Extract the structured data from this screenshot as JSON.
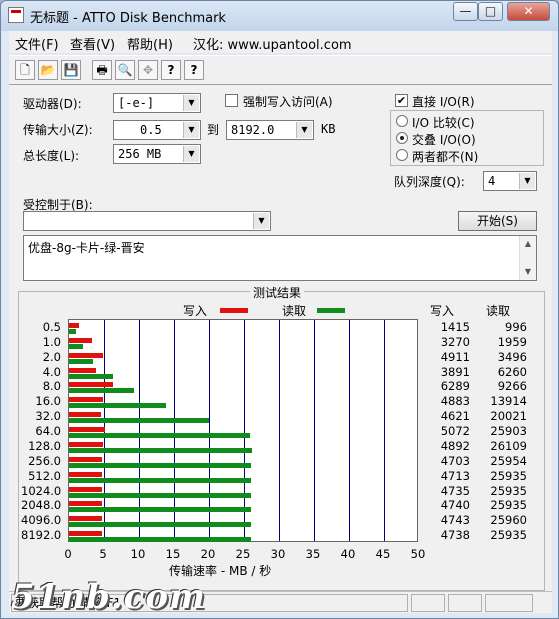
{
  "window": {
    "title": "无标题 - ATTO Disk Benchmark"
  },
  "menu": [
    "文件(F)",
    "查看(V)",
    "帮助(H)",
    "汉化: www.upantool.com"
  ],
  "toolbar": {
    "icons": [
      "new-file-icon",
      "open-folder-icon",
      "save-icon",
      "print-icon",
      "print-preview-icon",
      "move-icon",
      "help-icon",
      "context-help-icon"
    ],
    "glyphs": [
      "🗋",
      "📂",
      "💾",
      "🖶",
      "🔍",
      "✥",
      "?",
      "?"
    ]
  },
  "settings": {
    "drive_label": "驱动器(D):",
    "drive_value": "[-e-]",
    "force_write_label": "强制写入访问(A)",
    "transfer_size_label": "传输大小(Z):",
    "transfer_from": "0.5",
    "transfer_to_label": "到",
    "transfer_to": "8192.0",
    "transfer_unit": "KB",
    "total_length_label": "总长度(L):",
    "total_length": "256 MB",
    "direct_io_label": "直接 I/O(R)",
    "direct_io_checked": true,
    "io_compare_label": "I/O 比较(C)",
    "overlap_io_label": "交叠 I/O(O)",
    "neither_label": "两者都不(N)",
    "selected_mode": "overlap",
    "queue_depth_label": "队列深度(Q):",
    "queue_depth": "4",
    "controlled_by_label": "受控制于(B):",
    "controlled_by": "",
    "start_button": "开始(S)",
    "description": "优盘-8g-卡片-绿-晋安"
  },
  "results": {
    "group_title": "测试结果",
    "legend_write": "写入",
    "legend_read": "读取",
    "col_write": "写入",
    "col_read": "读取",
    "xlabel": "传输速率 - MB / 秒"
  },
  "colors": {
    "write": "#e31010",
    "read": "#108c1c",
    "grid": "#000080"
  },
  "chart_data": {
    "type": "bar",
    "orientation": "horizontal",
    "xlabel": "传输速率 - MB / 秒",
    "xlim": [
      0,
      50
    ],
    "xticks": [
      0,
      5,
      10,
      15,
      20,
      25,
      30,
      35,
      40,
      45,
      50
    ],
    "categories": [
      "0.5",
      "1.0",
      "2.0",
      "4.0",
      "8.0",
      "16.0",
      "32.0",
      "64.0",
      "128.0",
      "256.0",
      "512.0",
      "1024.0",
      "2048.0",
      "4096.0",
      "8192.0"
    ],
    "series": [
      {
        "name": "写入",
        "values_kb_s": [
          1415,
          3270,
          4911,
          3891,
          6289,
          4883,
          4621,
          5072,
          4892,
          4703,
          4713,
          4735,
          4740,
          4743,
          4738
        ]
      },
      {
        "name": "读取",
        "values_kb_s": [
          996,
          1959,
          3496,
          6260,
          9266,
          13914,
          20021,
          25903,
          26109,
          25954,
          25935,
          25935,
          25935,
          25960,
          25935
        ]
      }
    ]
  },
  "status": {
    "text": "要获取帮助,请按 F1"
  },
  "watermark": "51nb.com"
}
